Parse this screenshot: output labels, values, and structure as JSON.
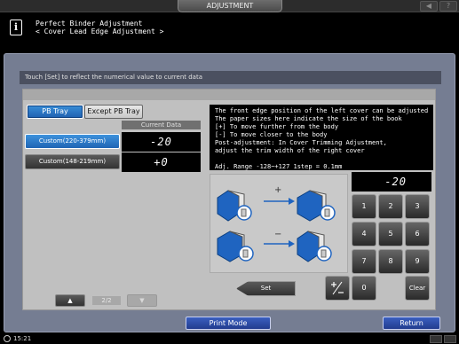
{
  "window": {
    "title": "ADJUSTMENT"
  },
  "header": {
    "line1": "Perfect Binder Adjustment",
    "line2": "< Cover Lead Edge Adjustment >"
  },
  "message": "Touch [Set] to reflect the numerical value to current data",
  "tabs": {
    "pb_tray": "PB Tray",
    "except_pb_tray": "Except PB Tray"
  },
  "current_data_label": "Current Data",
  "rows": [
    {
      "label": "Custom(220-379mm)",
      "value": "-20"
    },
    {
      "label": "Custom(148-219mm)",
      "value": "+0"
    }
  ],
  "pagination": {
    "page": "2/2",
    "up": "▲",
    "down": "▼"
  },
  "info": [
    "The front edge position of the left cover can be adjusted",
    "The paper sizes here indicate the size of the book",
    "[+] To move further from the body",
    "[-] To move closer to the body",
    "Post-adjustment: In Cover Trimming Adjustment,",
    "adjust the trim width of the right cover",
    "",
    "Adj. Range -128~+127 1step = 0.1mm"
  ],
  "illustration": {
    "plus": "+",
    "minus": "−"
  },
  "numeric_display": "-20",
  "keypad": {
    "k1": "1",
    "k2": "2",
    "k3": "3",
    "k4": "4",
    "k5": "5",
    "k6": "6",
    "k7": "7",
    "k8": "8",
    "k9": "9",
    "k0": "0",
    "clear": "Clear"
  },
  "set_label": "Set",
  "bottom": {
    "print_mode": "Print Mode",
    "return": "Return"
  },
  "status": {
    "time": "15:21"
  },
  "topbar_buttons": {
    "b1": "◀",
    "b2": "?"
  },
  "colors": {
    "accent_blue": "#1f64b4",
    "panel_bg": "#757d92",
    "book_blue": "#1f64c0"
  }
}
